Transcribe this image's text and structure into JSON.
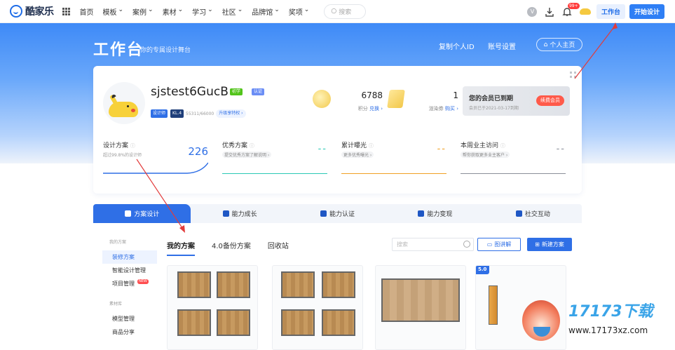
{
  "nav": {
    "logo_text": "酷家乐",
    "menu": [
      "首页",
      "模板",
      "案例",
      "素材",
      "学习",
      "社区",
      "品牌馆",
      "奖项"
    ],
    "dropdown_flags": [
      false,
      true,
      true,
      true,
      true,
      true,
      true,
      true
    ],
    "search_placeholder": "搜索",
    "badge_count": "99+",
    "workbench_label": "工作台",
    "start_design_label": "开始设计",
    "vip_glyph": "V"
  },
  "hero": {
    "title": "工作台",
    "subtitle": "你的专属设计舞台",
    "copy_id": "复制个人ID",
    "account_settings": "账号设置",
    "home_link": "个人主页"
  },
  "profile": {
    "username": "sjstest6GucB",
    "tag_green": "初学",
    "tag_blue": "认证",
    "role": "设计师",
    "level": "KL.4",
    "points": "55311/66000",
    "upgrade": "升级享特权 ›"
  },
  "stats": {
    "points_value": "6788",
    "points_label": "积分",
    "points_action": "兑换 ›",
    "coupon_value": "1",
    "coupon_label": "渲染券",
    "coupon_action": "购买 ›"
  },
  "membership": {
    "title": "您的会员已到期",
    "date": "会员已于2021-03-17到期",
    "renew": "续费会员"
  },
  "metrics": [
    {
      "title": "设计方案",
      "sub": "超过99.8%的设计师",
      "value": "226",
      "color": "#2f6fe6"
    },
    {
      "title": "优秀方案",
      "sub": "提交优秀方案了解说明 ›",
      "value": "--",
      "color": "#2bc9b4"
    },
    {
      "title": "累计曝光",
      "sub": "更多优秀曝光 ›",
      "value": "--",
      "color": "#f0a023"
    },
    {
      "title": "本周业主访问",
      "sub": "帮你获取更多业主客户 ›",
      "value": "--",
      "color": "#8a8f99"
    }
  ],
  "tabs": [
    "方案设计",
    "能力成长",
    "能力认证",
    "能力变现",
    "社交互动"
  ],
  "sidebar": {
    "group1": "我的方案",
    "items1": [
      "装修方案",
      "智能设计管理",
      "项目管理"
    ],
    "new_tag": "NEW",
    "group2": "素材库",
    "items2": [
      "模型管理",
      "商品分享"
    ]
  },
  "subtabs": [
    "我的方案",
    "4.0备份方案",
    "回收站"
  ],
  "toolbar": {
    "search_placeholder": "搜索",
    "lecture": "图讲解",
    "new_plan": "新建方案"
  },
  "version_badge": "5.0",
  "watermark": {
    "brand": "17173下载",
    "url": "www.17173xz.com"
  },
  "colors": {
    "primary": "#2f6fe6",
    "renew": "#ff5a4a"
  }
}
